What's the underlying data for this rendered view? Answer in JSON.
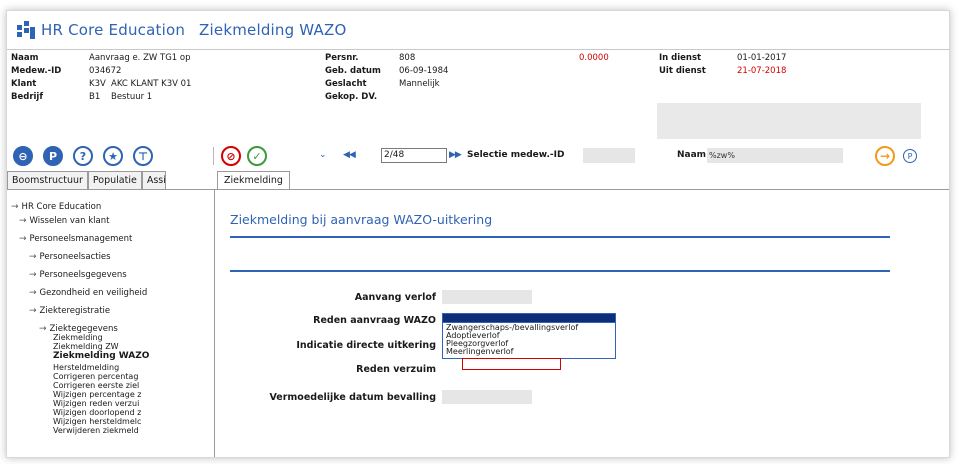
{
  "app": {
    "name": "HR Core Education",
    "screen": "Ziekmelding WAZO"
  },
  "header": {
    "naam_label": "Naam",
    "naam_value": "Aanvraag e. ZW TG1 op",
    "medew_label": "Medew.-ID",
    "medew_value": "034672",
    "klant_label": "Klant",
    "klant_code": "K3V",
    "klant_value": "AKC KLANT K3V 01",
    "bedrijf_label": "Bedrijf",
    "bedrijf_code": "B1",
    "bedrijf_value": "Bestuur 1",
    "persnr_label": "Persnr.",
    "persnr_value": "808",
    "gebdatum_label": "Geb. datum",
    "gebdatum_value": "06-09-1984",
    "geslacht_label": "Geslacht",
    "geslacht_value": "Mannelijk",
    "gekop_label": "Gekop. DV.",
    "amount_value": "0.0000",
    "indienst_label": "In dienst",
    "indienst_value": "01-01-2017",
    "uitdienst_label": "Uit dienst",
    "uitdienst_value": "21-07-2018",
    "accent_color": "#d40000"
  },
  "toolbar": {
    "icons": [
      "back-icon",
      "pin-icon",
      "help-icon",
      "favorite-icon",
      "filter-icon",
      "cancel-icon",
      "confirm-icon"
    ],
    "record_value": "2/48",
    "selectie_label": "Selectie medew.-ID",
    "naam_label": "Naam",
    "naam_value": "%zw%"
  },
  "tabs": [
    "Boomstructuur",
    "Populatie",
    "Assi"
  ],
  "content_tab": "Ziekmelding",
  "tree": {
    "root": "HR Core Education",
    "l1": [
      "Wisselen van klant",
      "Personeelsmanagement"
    ],
    "l2": [
      "Personeelsacties",
      "Personeelsgegevens",
      "Gezondheid en veiligheid",
      "Ziekteregistratie"
    ],
    "l3": "Ziektegegevens",
    "leaves": [
      "Ziekmelding",
      "Ziekmelding ZW",
      "Ziekmelding WAZO",
      "Hersteldmelding",
      "Corrigeren percentag",
      "Corrigeren eerste ziel",
      "Wijzigen percentage z",
      "Wijzigen reden verzui",
      "Wijzigen doorlopend z",
      "Wijzigen hersteldmelc",
      "Verwijderen ziekmeld"
    ]
  },
  "form": {
    "title": "Ziekmelding bij aanvraag WAZO-uitkering",
    "aanvang_label": "Aanvang verlof",
    "reden_aanvraag_label": "Reden aanvraag WAZO",
    "indicatie_label": "Indicatie directe uitkering",
    "reden_verzuim_label": "Reden verzuim",
    "vermoedelijke_label": "Vermoedelijke datum bevalling",
    "dropdown_options": [
      "Zwangerschaps-/bevallingsverlof",
      "Adoptieverlof",
      "Pleegzorgverlof",
      "Meerlingenverlof"
    ],
    "highlighted_option": "Meerlingenverlof",
    "accent_color": "#2f63b3"
  }
}
